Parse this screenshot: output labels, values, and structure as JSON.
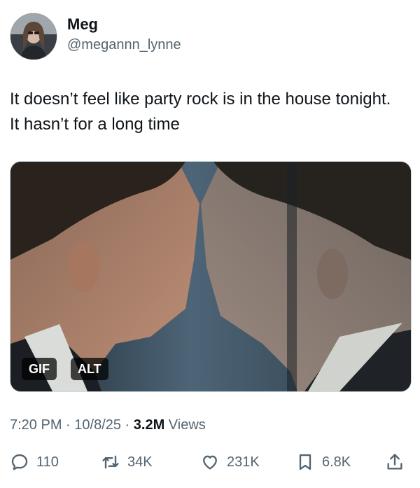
{
  "author": {
    "name": "Meg",
    "handle": "@megannn_lynne"
  },
  "tweet": {
    "text": "It doesn’t feel like party rock is in the house tonight. It hasn’t for a long time"
  },
  "media": {
    "badges": {
      "gif": "GIF",
      "alt": "ALT"
    }
  },
  "meta": {
    "time": "7:20 PM",
    "separator1": " · ",
    "date": "10/8/25",
    "separator2": " · ",
    "views_count": "3.2M",
    "views_label": " Views"
  },
  "actions": {
    "replies": "110",
    "reposts": "34K",
    "likes": "231K",
    "bookmarks": "6.8K"
  },
  "icons": {
    "reply": "reply-icon",
    "repost": "repost-icon",
    "like": "heart-icon",
    "bookmark": "bookmark-icon",
    "share": "share-icon"
  },
  "colors": {
    "text": "#0f1419",
    "secondary": "#536471"
  }
}
